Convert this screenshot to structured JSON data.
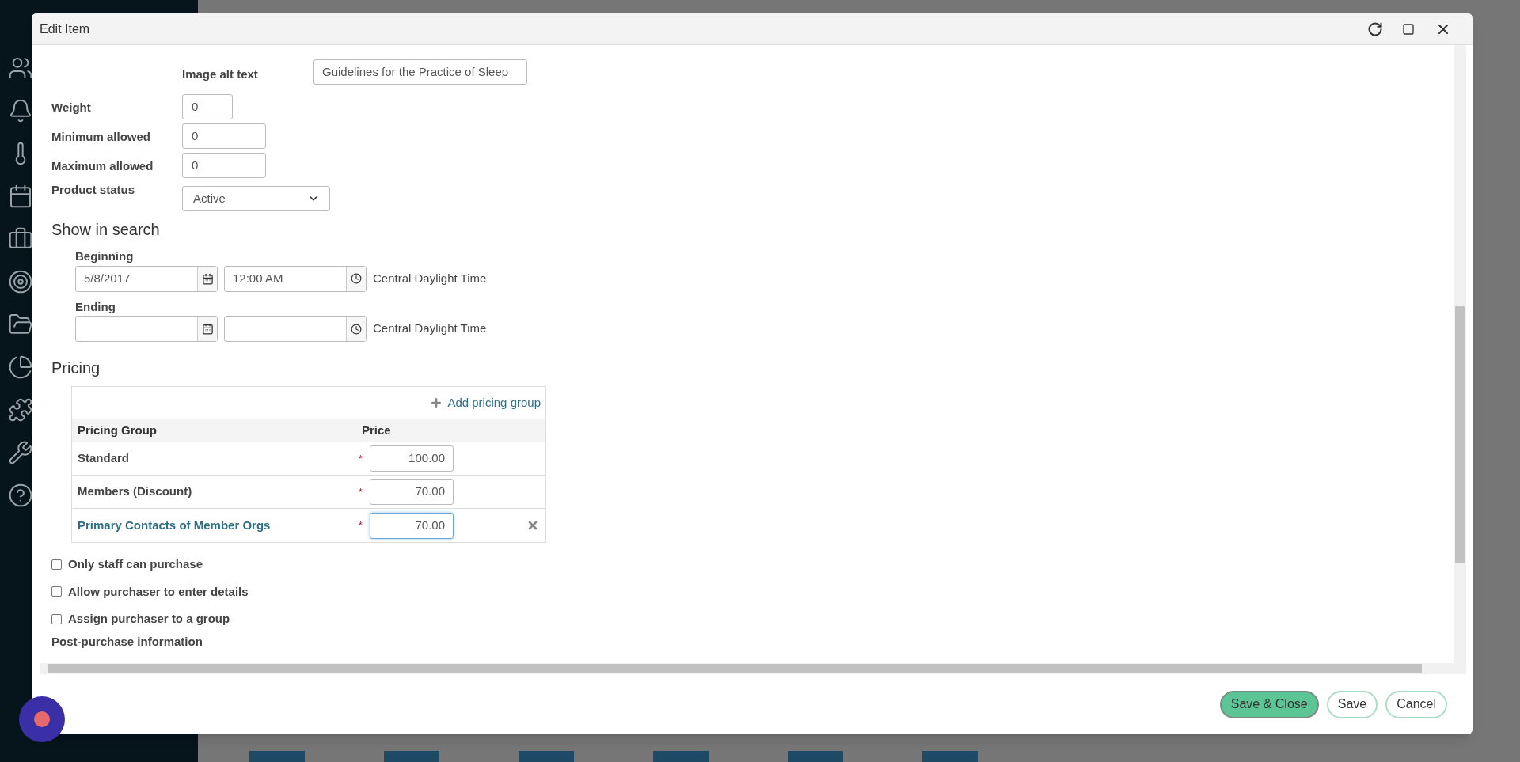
{
  "dialog": {
    "title": "Edit Item"
  },
  "fields": [
    {
      "kind": "text",
      "label": "Image alt text",
      "value": "Guidelines for the Practice of Sleep"
    },
    {
      "kind": "number",
      "label": "Weight",
      "value": "0"
    },
    {
      "kind": "number",
      "label": "Minimum allowed",
      "value": "0"
    },
    {
      "kind": "number",
      "label": "Maximum allowed",
      "value": "0"
    },
    {
      "kind": "select",
      "label": "Product status",
      "value": "Active"
    }
  ],
  "show_in_search": {
    "heading": "Show in search",
    "rows": [
      {
        "label": "Beginning",
        "date": "5/8/2017",
        "time": "12:00 AM",
        "timezone": "Central Daylight Time"
      },
      {
        "label": "Ending",
        "timezone": "Central Daylight Time"
      }
    ]
  },
  "pricing": {
    "heading": "Pricing",
    "add_label": "Add pricing group",
    "columns": [
      "Pricing Group",
      "Price"
    ],
    "rows": [
      {
        "name": "Standard",
        "price": "100.00",
        "required_mark": "*",
        "kind": "plain",
        "removable": false,
        "focused": false
      },
      {
        "name": "Members (Discount)",
        "price": "70.00",
        "required_mark": "*",
        "kind": "plain",
        "removable": false,
        "focused": false
      },
      {
        "name": "Primary Contacts of Member Orgs",
        "price": "70.00",
        "required_mark": "*",
        "kind": "link",
        "removable": true,
        "focused": true
      }
    ]
  },
  "checkboxes": [
    {
      "label": "Only staff can purchase",
      "checked": false
    },
    {
      "label": "Allow purchaser to enter details",
      "checked": false
    },
    {
      "label": "Assign purchaser to a group",
      "checked": false
    }
  ],
  "cut_off_label": "Post-purchase information",
  "buttons": [
    {
      "label": "Save & Close",
      "primary": true
    },
    {
      "label": "Save",
      "primary": false
    },
    {
      "label": "Cancel",
      "primary": false
    }
  ]
}
